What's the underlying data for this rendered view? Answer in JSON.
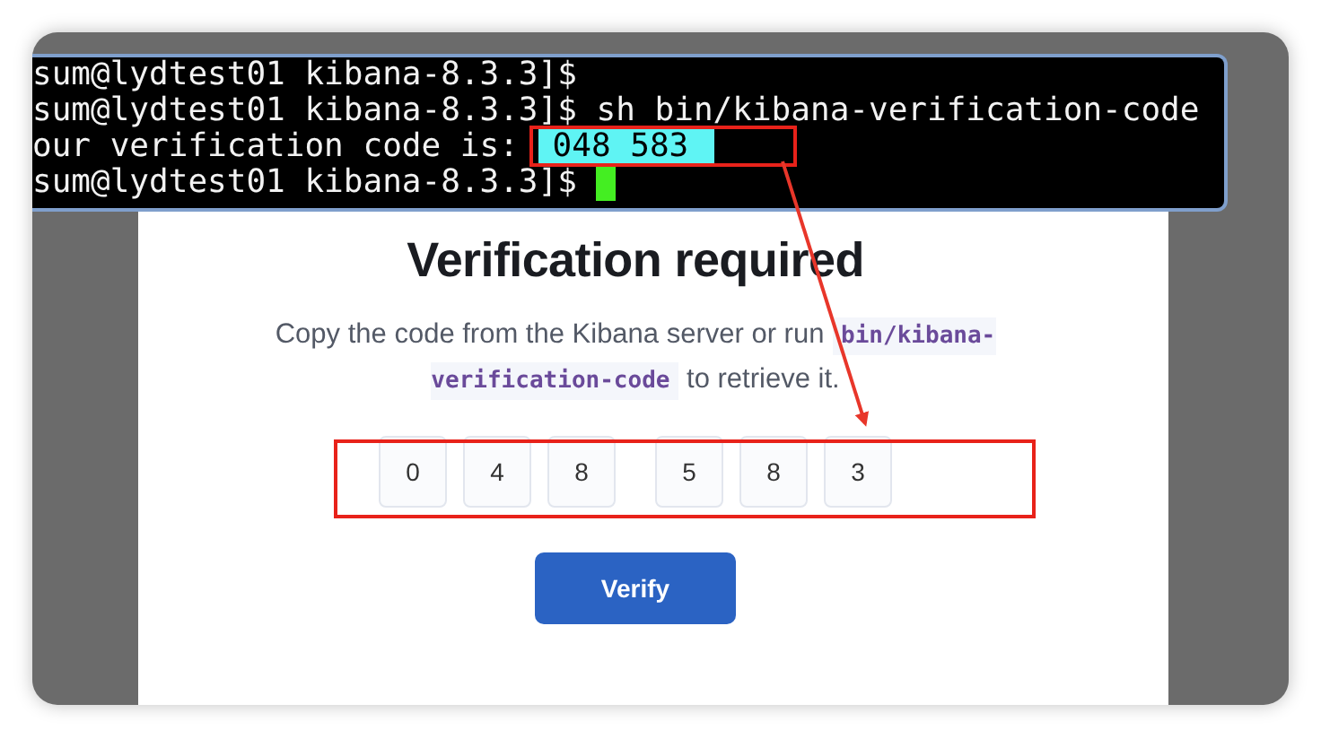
{
  "terminal": {
    "lines": [
      {
        "text": "sum@lydtest01 kibana-8.3.3]$",
        "cursor": false
      },
      {
        "text": "sum@lydtest01 kibana-8.3.3]$ sh bin/kibana-verification-code",
        "cursor": false
      },
      {
        "text": "our verification code is: ",
        "highlight": "048 583",
        "cursor": false
      },
      {
        "text": "sum@lydtest01 kibana-8.3.3]$",
        "cursor": true
      }
    ]
  },
  "card": {
    "title": "Verification required",
    "description": [
      {
        "kind": "text",
        "text": "Copy the code from the Kibana server or run "
      },
      {
        "kind": "code",
        "text": "bin/kibana-verification-code"
      },
      {
        "kind": "text",
        "text": " to retrieve it."
      }
    ],
    "code_groups": [
      [
        "0",
        "4",
        "8"
      ],
      [
        "5",
        "8",
        "3"
      ]
    ],
    "button": "Verify"
  }
}
